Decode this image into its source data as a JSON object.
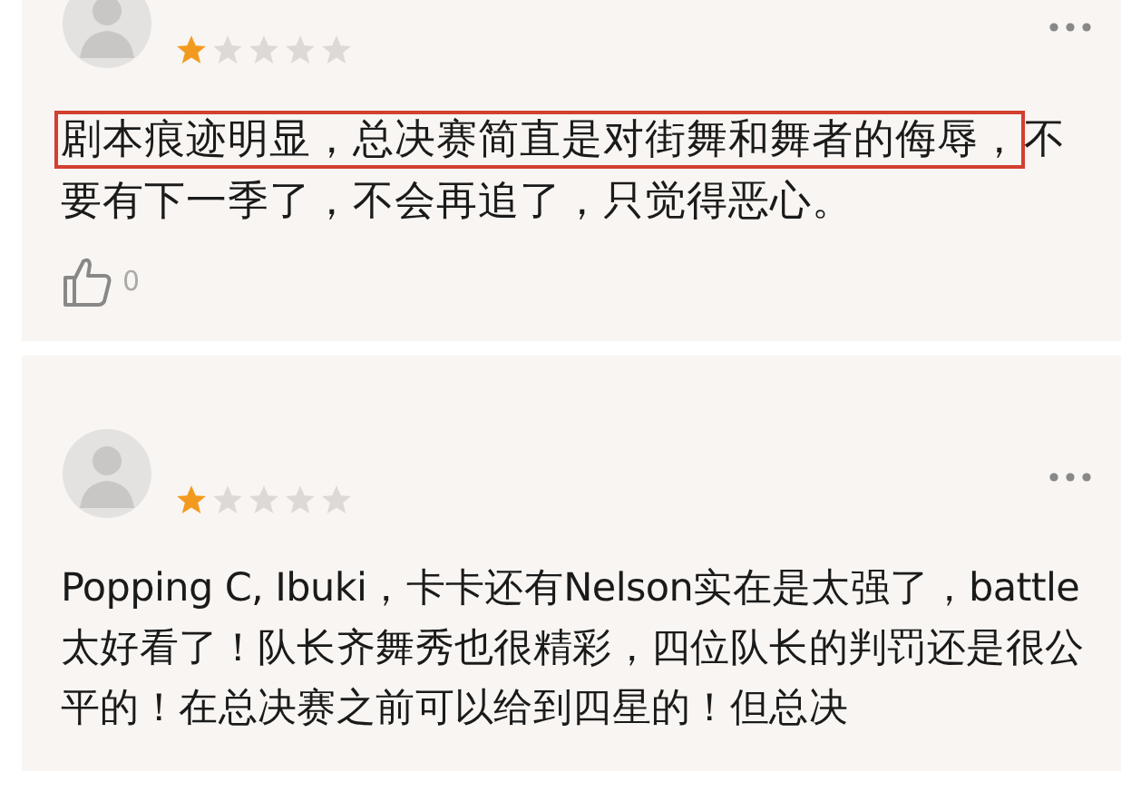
{
  "reviews": [
    {
      "stars": 1,
      "highlight": "剧本痕迹明显，总决赛简直是对街舞和舞者的侮辱，",
      "text": "不要有下一季了，不会再追了，只觉得恶心。",
      "likes": "0"
    },
    {
      "stars": 1,
      "text": "Popping C, Ibuki，卡卡还有Nelson实在是太强了，battle太好看了！队长齐舞秀也很精彩，四位队长的判罚还是很公平的！在总决赛之前可以给到四星的！但总决"
    }
  ]
}
